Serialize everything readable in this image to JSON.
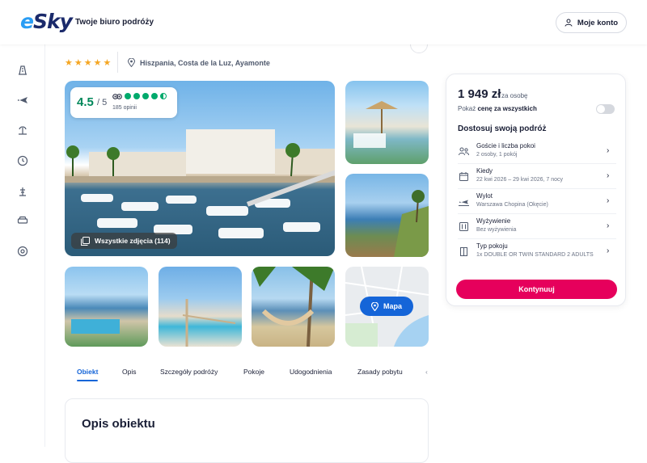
{
  "header": {
    "logo": "eSky",
    "tagline": "Twoje biuro podróży",
    "account_label": "Moje konto"
  },
  "sidebar": {
    "icons": [
      "hotel-icon",
      "flight-icon",
      "vacation-icon",
      "last-minute-icon",
      "beach-icon",
      "car-icon",
      "support-icon"
    ]
  },
  "hotel": {
    "stars": "★★★★★",
    "location": "Hiszpania, Costa de la Luz, Ayamonte"
  },
  "gallery": {
    "rating_score": "4.5",
    "rating_max": "/ 5",
    "rating_count": "185 opinii",
    "all_photos_label": "Wszystkie zdjęcia (114)",
    "map_label": "Mapa"
  },
  "tabs": [
    "Obiekt",
    "Opis",
    "Szczegóły podróży",
    "Pokoje",
    "Udogodnienia",
    "Zasady pobytu"
  ],
  "description": {
    "title": "Opis obiektu"
  },
  "booking": {
    "price": "1 949 zł",
    "price_suffix": "za osobę",
    "show_total_prefix": "Pokaż",
    "show_total_bold": "cenę za wszystkich",
    "customize_title": "Dostosuj swoją podróż",
    "options": [
      {
        "label": "Goście i liczba pokoi",
        "value": "2 osoby, 1 pokój",
        "icon": "guests-icon"
      },
      {
        "label": "Kiedy",
        "value": "22 kwi 2026 – 29 kwi 2026, 7 nocy",
        "icon": "calendar-icon"
      },
      {
        "label": "Wylot",
        "value": "Warszawa Chopina (Okęcie)",
        "icon": "departure-icon"
      },
      {
        "label": "Wyżywienie",
        "value": "Bez wyżywienia",
        "icon": "meal-icon"
      },
      {
        "label": "Typ pokoju",
        "value": "1x DOUBLE OR TWIN STANDARD 2 ADULTS",
        "icon": "room-icon"
      }
    ],
    "continue_label": "Kontynuuj"
  },
  "colors": {
    "brand_blue": "#1565d8",
    "cta_pink": "#e6005c",
    "rating_green": "#00aa6c",
    "star_gold": "#f5a623"
  }
}
